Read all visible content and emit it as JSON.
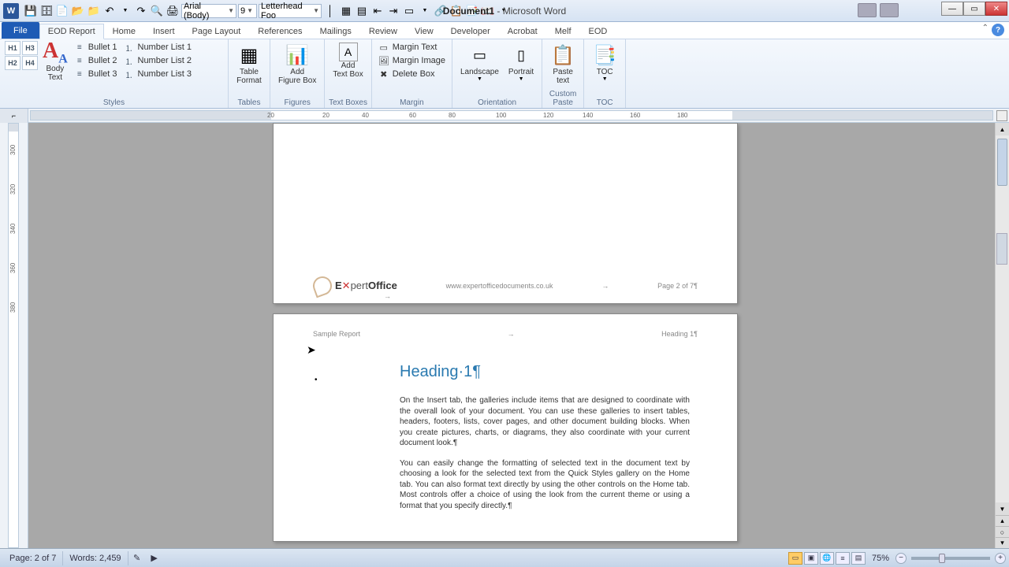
{
  "title": {
    "doc": "Document1",
    "app": "Microsoft Word"
  },
  "qat": {
    "font_name": "Arial (Body)",
    "font_size": "9",
    "style_name": "Letterhead Foo"
  },
  "tabs": {
    "file": "File",
    "items": [
      "EOD Report",
      "Home",
      "Insert",
      "Page Layout",
      "References",
      "Mailings",
      "Review",
      "View",
      "Developer",
      "Acrobat",
      "Melf",
      "EOD"
    ],
    "active_index": 0
  },
  "ribbon": {
    "styles": {
      "label": "Styles",
      "h1": "H1",
      "h2": "H2",
      "h3": "H3",
      "h4": "H4",
      "body_text": "Body\nText",
      "bullets": [
        "Bullet 1",
        "Bullet 2",
        "Bullet 3"
      ],
      "numbers": [
        "Number List 1",
        "Number List 2",
        "Number List 3"
      ]
    },
    "tables": {
      "label": "Tables",
      "btn": "Table\nFormat"
    },
    "figures": {
      "label": "Figures",
      "btn": "Add\nFigure Box"
    },
    "textboxes": {
      "label": "Text Boxes",
      "btn": "Add\nText Box"
    },
    "margin": {
      "label": "Margin",
      "items": [
        "Margin Text",
        "Margin Image",
        "Delete Box"
      ]
    },
    "orientation": {
      "label": "Orientation",
      "landscape": "Landscape",
      "portrait": "Portrait"
    },
    "custom_paste": {
      "label": "Custom Paste",
      "btn": "Paste\ntext"
    },
    "toc": {
      "label": "TOC",
      "btn": "TOC"
    }
  },
  "ruler_h": [
    "20",
    "",
    "20",
    "40",
    "60",
    "80",
    "100",
    "120",
    "140",
    "160",
    "180"
  ],
  "ruler_v": [
    "300",
    "320",
    "340",
    "360",
    "380"
  ],
  "page1": {
    "footer_logo": "E pertOffice",
    "footer_url": "www.expertofficedocuments.co.uk",
    "footer_page": "Page 2 of 7¶"
  },
  "page2": {
    "header_left": "Sample Report",
    "header_right": "Heading 1¶",
    "heading": "Heading·1¶",
    "para1": "On the Insert tab, the galleries include items that are designed to coordinate with the overall look of your document. You can use these galleries to insert tables, headers, footers, lists, cover pages, and other document building blocks. When you create pictures, charts, or diagrams, they also coordinate with your current document look.¶",
    "para2": "You can easily change the formatting of selected text in the document text by choosing a look for the selected text from the Quick Styles gallery on the Home tab. You can also format text directly by using the other controls on the Home tab. Most controls offer a choice of using the look from the current theme or using a format that you specify directly.¶"
  },
  "status": {
    "page": "Page: 2 of 7",
    "words": "Words: 2,459",
    "zoom": "75%"
  }
}
